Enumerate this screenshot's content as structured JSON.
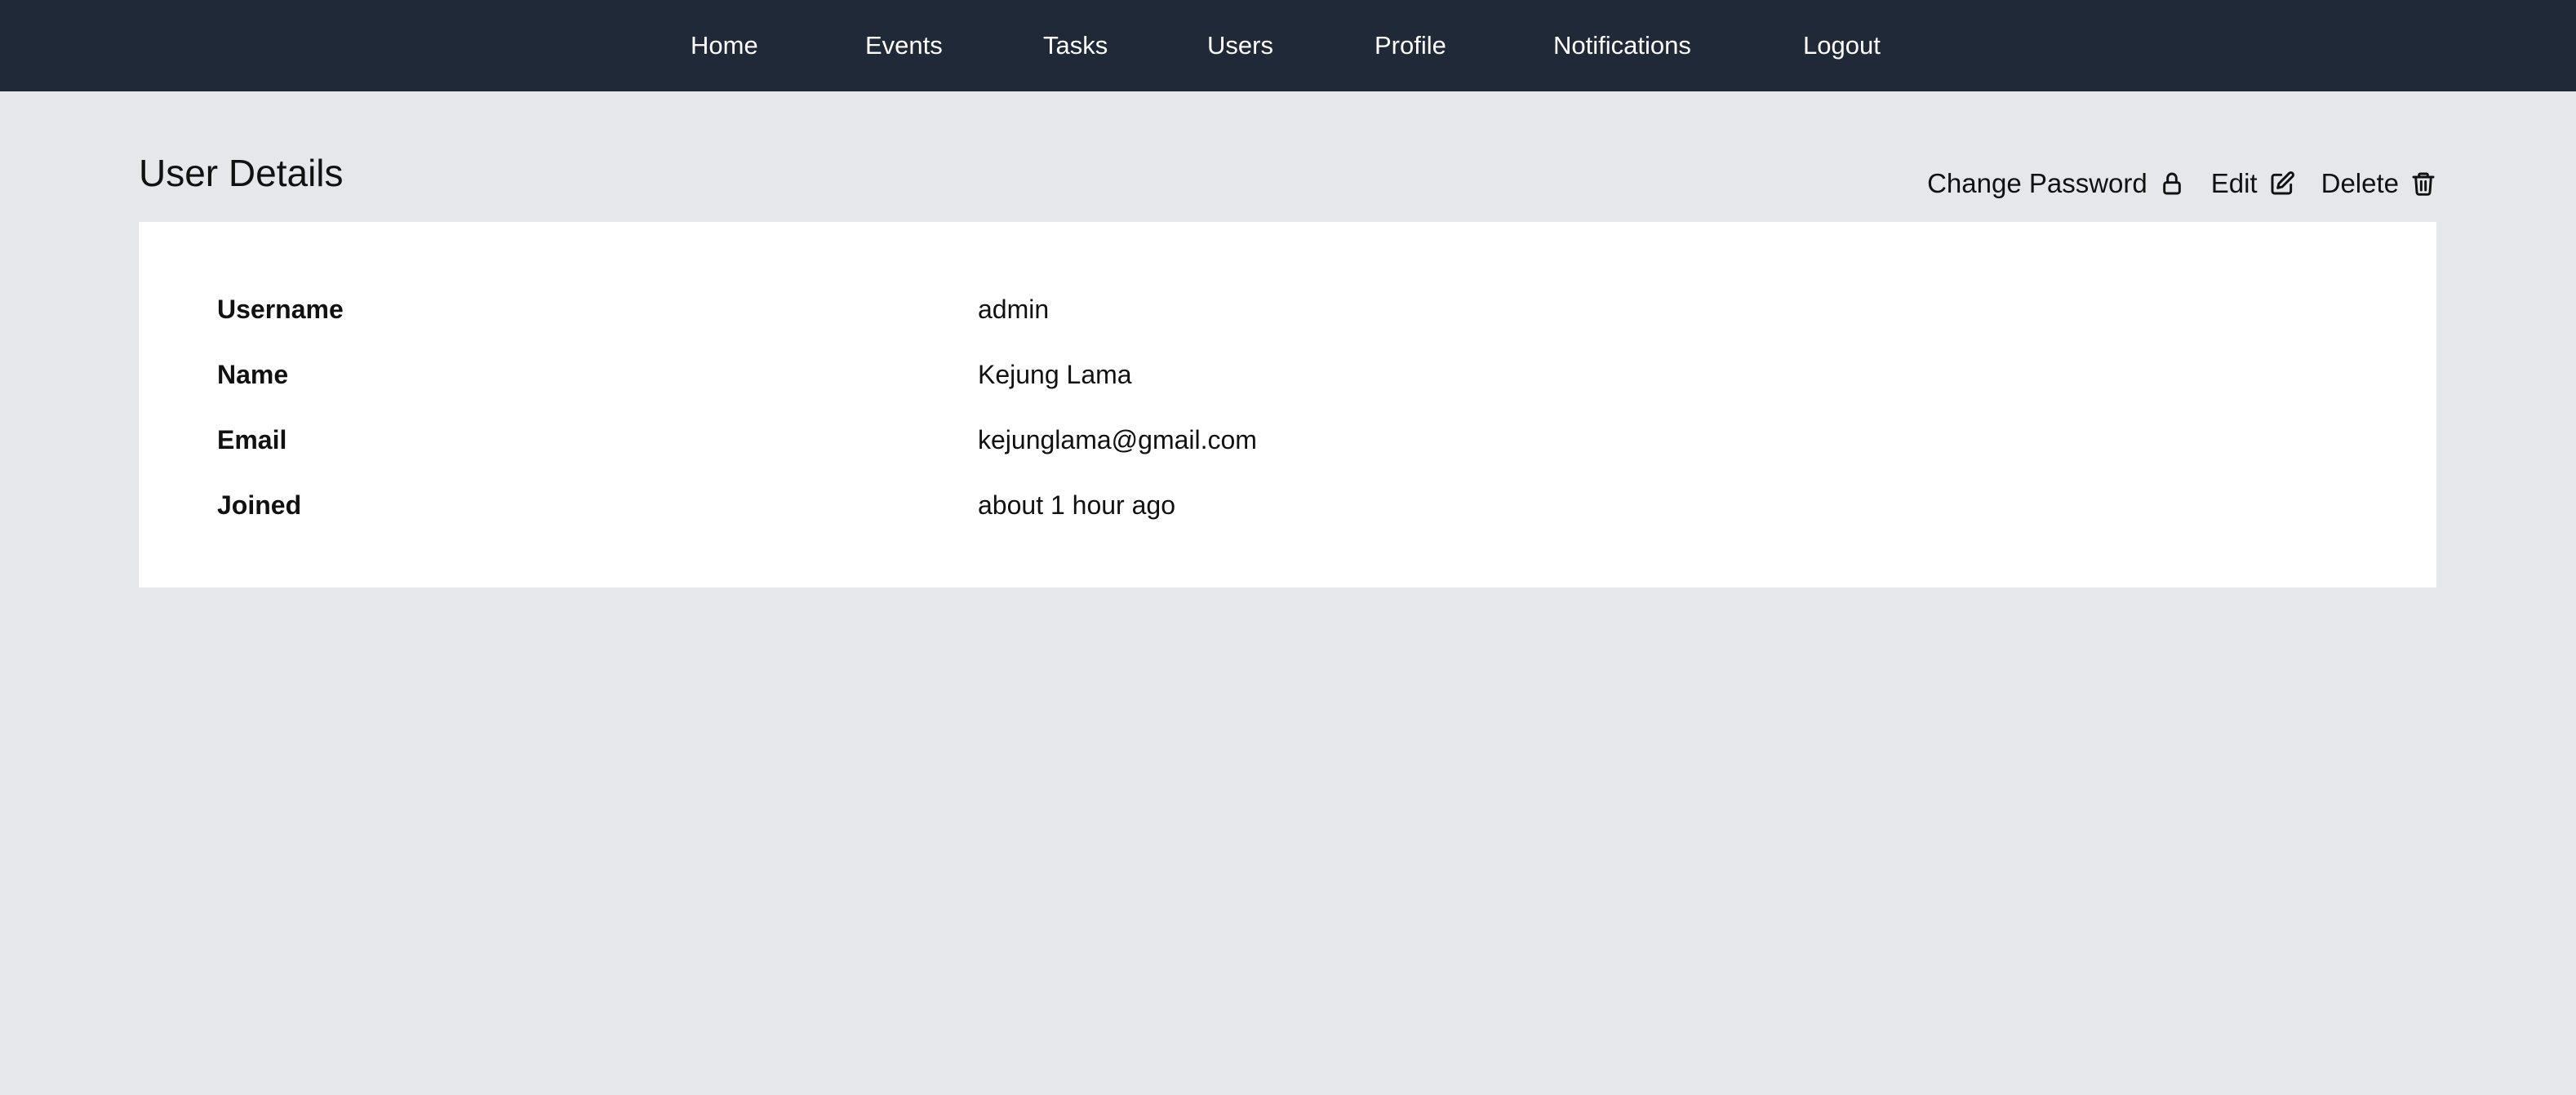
{
  "nav": {
    "items": [
      {
        "label": "Home"
      },
      {
        "label": "Events"
      },
      {
        "label": "Tasks"
      },
      {
        "label": "Users"
      },
      {
        "label": "Profile"
      },
      {
        "label": "Notifications"
      },
      {
        "label": "Logout"
      }
    ]
  },
  "page": {
    "title": "User Details"
  },
  "actions": {
    "change_password": {
      "label": "Change Password",
      "icon": "lock-icon"
    },
    "edit": {
      "label": "Edit",
      "icon": "edit-icon"
    },
    "delete": {
      "label": "Delete",
      "icon": "trash-icon"
    }
  },
  "details": [
    {
      "label": "Username",
      "value": "admin"
    },
    {
      "label": "Name",
      "value": "Kejung Lama"
    },
    {
      "label": "Email",
      "value": "kejunglama@gmail.com"
    },
    {
      "label": "Joined",
      "value": "about 1 hour ago"
    }
  ],
  "colors": {
    "navbar": "#1f2937",
    "background": "#e5e7eb",
    "card": "#ffffff",
    "text": "#111111"
  }
}
